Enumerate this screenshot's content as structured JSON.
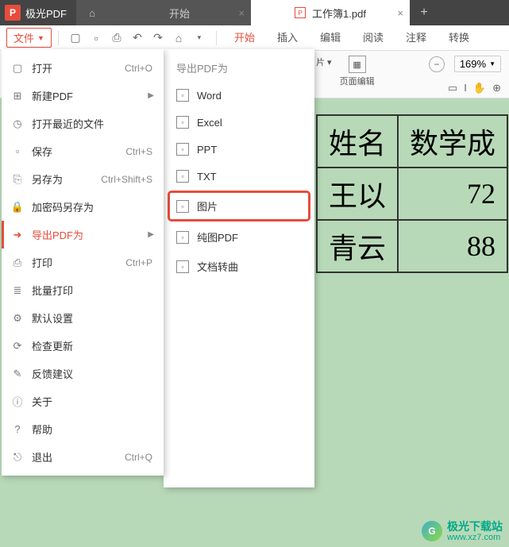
{
  "app": {
    "name": "极光PDF"
  },
  "tabs": {
    "start": "开始",
    "doc": "工作簿1.pdf"
  },
  "toolbar": {
    "file": "文件"
  },
  "menu": {
    "start": "开始",
    "insert": "插入",
    "edit": "编辑",
    "read": "阅读",
    "annotate": "注释",
    "convert": "转换"
  },
  "ribbon": {
    "pic": "片 ▾",
    "page_edit": "页面编辑",
    "zoom": "169%"
  },
  "file_menu": [
    {
      "icon": "folder",
      "label": "打开",
      "shortcut": "Ctrl+O"
    },
    {
      "icon": "plus",
      "label": "新建PDF",
      "arrow": true
    },
    {
      "icon": "clock",
      "label": "打开最近的文件"
    },
    {
      "icon": "save",
      "label": "保存",
      "shortcut": "Ctrl+S"
    },
    {
      "icon": "saveas",
      "label": "另存为",
      "shortcut": "Ctrl+Shift+S"
    },
    {
      "icon": "lock",
      "label": "加密码另存为"
    },
    {
      "icon": "export",
      "label": "导出PDF为",
      "arrow": true,
      "active": true
    },
    {
      "icon": "print",
      "label": "打印",
      "shortcut": "Ctrl+P"
    },
    {
      "icon": "batch",
      "label": "批量打印"
    },
    {
      "icon": "gear",
      "label": "默认设置"
    },
    {
      "icon": "update",
      "label": "检查更新"
    },
    {
      "icon": "feedback",
      "label": "反馈建议"
    },
    {
      "icon": "about",
      "label": "关于"
    },
    {
      "icon": "help",
      "label": "帮助"
    },
    {
      "icon": "exit",
      "label": "退出",
      "shortcut": "Ctrl+Q"
    }
  ],
  "export_menu": {
    "header": "导出PDF为",
    "items": [
      {
        "label": "Word"
      },
      {
        "label": "Excel"
      },
      {
        "label": "PPT"
      },
      {
        "label": "TXT"
      },
      {
        "label": "图片",
        "hl": true
      },
      {
        "label": "纯图PDF"
      },
      {
        "label": "文档转曲"
      }
    ]
  },
  "chart_data": {
    "type": "table",
    "columns": [
      "姓名",
      "数学成"
    ],
    "rows": [
      [
        "王以",
        "72"
      ],
      [
        "青云",
        "88"
      ]
    ]
  },
  "watermark": {
    "name": "极光下载站",
    "url": "www.xz7.com"
  }
}
